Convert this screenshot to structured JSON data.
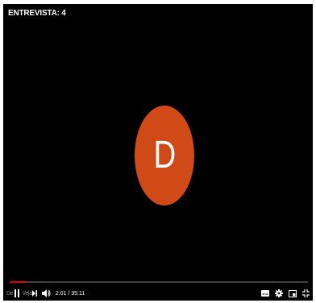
{
  "video": {
    "title": "ENTREVISTA: 4",
    "avatar_letter": "D",
    "avatar_color": "#d04a17"
  },
  "progress": {
    "played_fraction": 0.057,
    "fill_color": "#e00000"
  },
  "controls": {
    "left_partial_text": "De",
    "overlay_text": "Veja",
    "time": "2:01 / 35:11",
    "icons": [
      "play-pause-icon",
      "next-icon",
      "volume-icon",
      "subtitles-icon",
      "settings-gear-icon",
      "miniplayer-icon",
      "fullscreen-icon"
    ]
  }
}
